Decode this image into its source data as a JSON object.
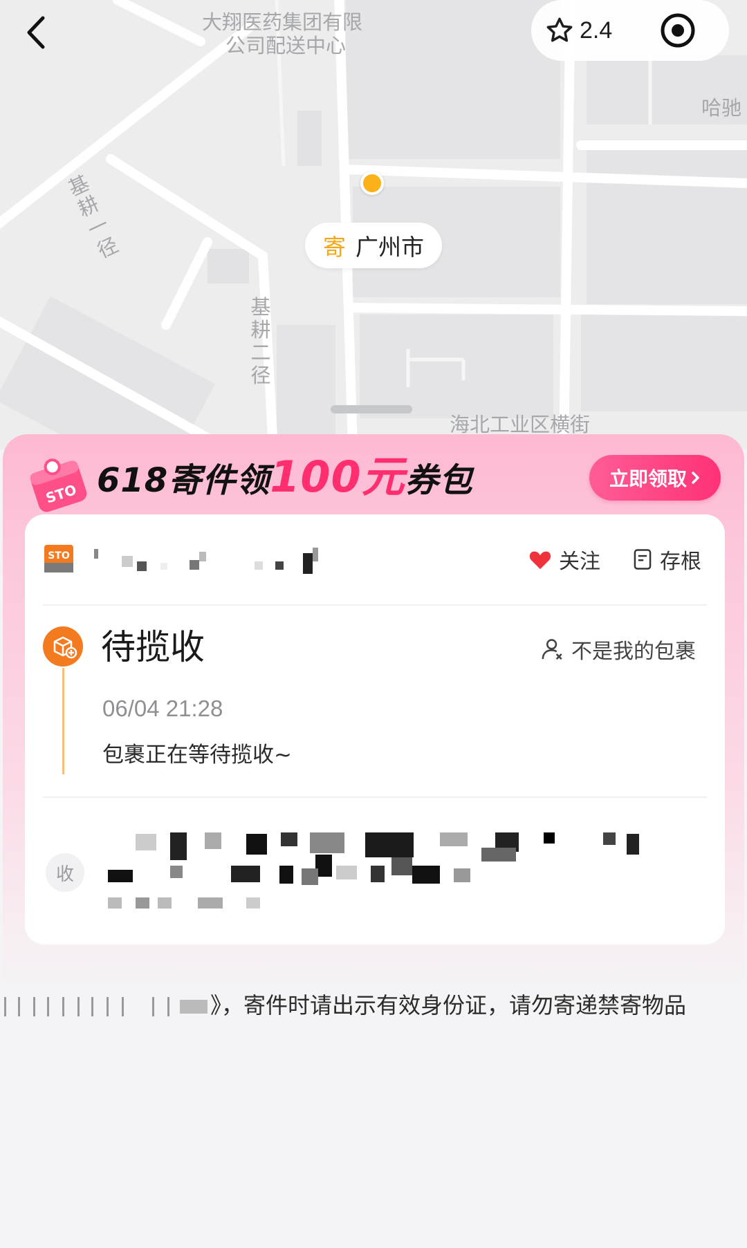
{
  "map": {
    "labels": {
      "pharma_line1": "大翔医药集团有限",
      "pharma_line2": "公司配送中心",
      "hachi": "哈驰",
      "road1": "基耕一径",
      "road2": "基耕二径",
      "street": "海北工业区横街"
    },
    "rating": "2.4",
    "chip": {
      "tag": "寄",
      "city": "广州市"
    },
    "colors": {
      "pin": "#fbb21a",
      "tag": "#f5a816"
    }
  },
  "promo": {
    "text_a": "618寄件领",
    "text_highlight": "100元",
    "text_b": "券包",
    "button": "立即领取",
    "gift_logo": "STO",
    "colors": {
      "highlight": "#ff2e6e",
      "button": "#ff3276"
    }
  },
  "card": {
    "carrier_logo": "STO",
    "follow": "关注",
    "stub": "存根",
    "status_title": "待揽收",
    "not_mine": "不是我的包裹",
    "status_time": "06/04 21:28",
    "status_message": "包裹正在等待揽收~",
    "receiver_badge": "收",
    "colors": {
      "status": "#f47a20",
      "heart": "#f0323c"
    }
  },
  "notice": {
    "text": "》，寄件时请出示有效身份证，请勿寄递禁寄物品"
  }
}
